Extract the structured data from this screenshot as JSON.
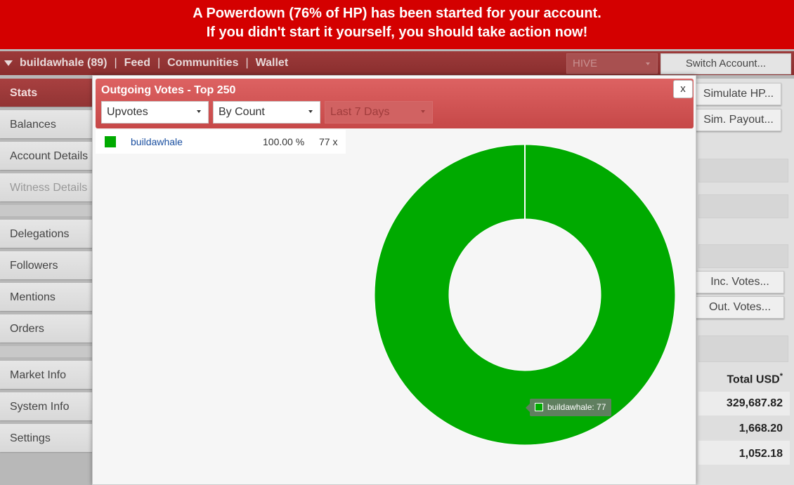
{
  "banner": {
    "line1": "A Powerdown (76% of HP) has been started for your account.",
    "line2": "If you didn't start it yourself, you should take action now!"
  },
  "nav": {
    "account": "buildawhale (89)",
    "links": [
      "Feed",
      "Communities",
      "Wallet"
    ],
    "separator": "|",
    "chain_select": "HIVE",
    "switch_account": "Switch Account..."
  },
  "sidebar": {
    "items": [
      "Stats",
      "Balances",
      "Account Details",
      "Witness Details",
      "Delegations",
      "Followers",
      "Mentions",
      "Orders",
      "Market Info",
      "System Info",
      "Settings"
    ]
  },
  "right_panel": {
    "simulate_hp": "Simulate HP...",
    "sim_payout": "Sim. Payout...",
    "inc_votes": "Inc. Votes...",
    "out_votes": "Out. Votes...",
    "total_usd_label": "Total USD",
    "total_usd_mark": "*",
    "values": [
      "329,687.82",
      "1,668.20",
      "1,052.18"
    ]
  },
  "modal": {
    "title": "Outgoing Votes - Top 250",
    "close": "x",
    "vote_type": "Upvotes",
    "sort_by": "By Count",
    "period": "Last 7 Days"
  },
  "legend": {
    "name": "buildawhale",
    "percent": "100.00 %",
    "count": "77 x"
  },
  "tooltip": "buildawhale: 77",
  "colors": {
    "banner": "#d40000",
    "slice": "#00aa00",
    "header": "#c64848"
  },
  "chart_data": {
    "type": "pie",
    "labels": [
      "buildawhale"
    ],
    "values": [
      77
    ],
    "donut": true
  }
}
